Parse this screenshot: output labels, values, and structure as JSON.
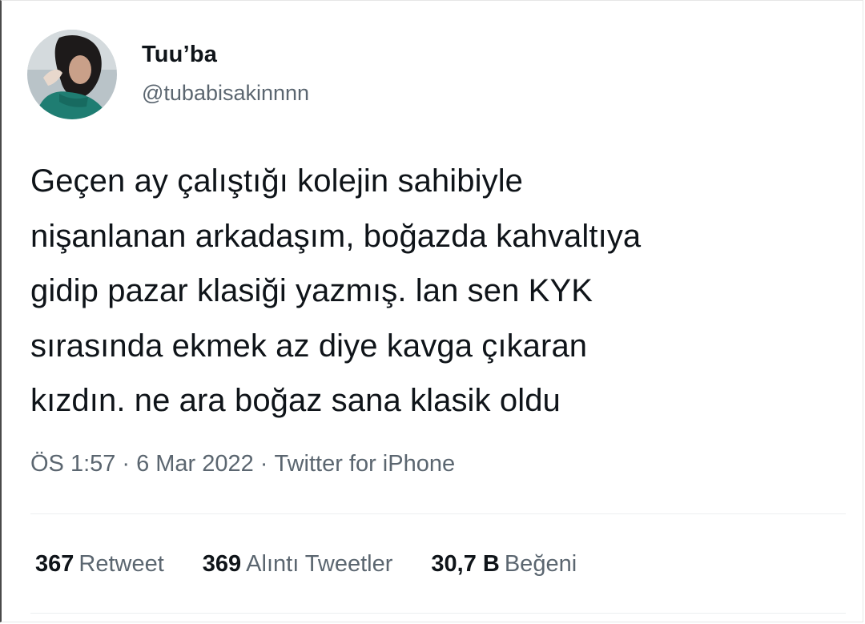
{
  "tweet": {
    "author": {
      "display_name": "Tuu’ba",
      "handle": "@tubabisakinnnn"
    },
    "text_lines": [
      "Geçen ay çalıştığı kolejin sahibiyle",
      "nişanlanan arkadaşım, boğazda kahvaltıya",
      "gidip pazar klasiği yazmış. lan sen KYK",
      "sırasında ekmek az diye kavga çıkaran",
      "kızdın. ne ara boğaz sana klasik oldu"
    ],
    "time": "ÖS 1:57",
    "separator": "·",
    "date": "6 Mar 2022",
    "source": "Twitter for iPhone",
    "stats": {
      "retweets_count": "367",
      "retweets_label": "Retweet",
      "quotes_count": "369",
      "quotes_label": "Alıntı Tweetler",
      "likes_count": "30,7 B",
      "likes_label": "Beğeni"
    }
  },
  "colors": {
    "text_primary": "#0f1419",
    "text_secondary": "#5b6670",
    "divider": "#eceff1"
  }
}
